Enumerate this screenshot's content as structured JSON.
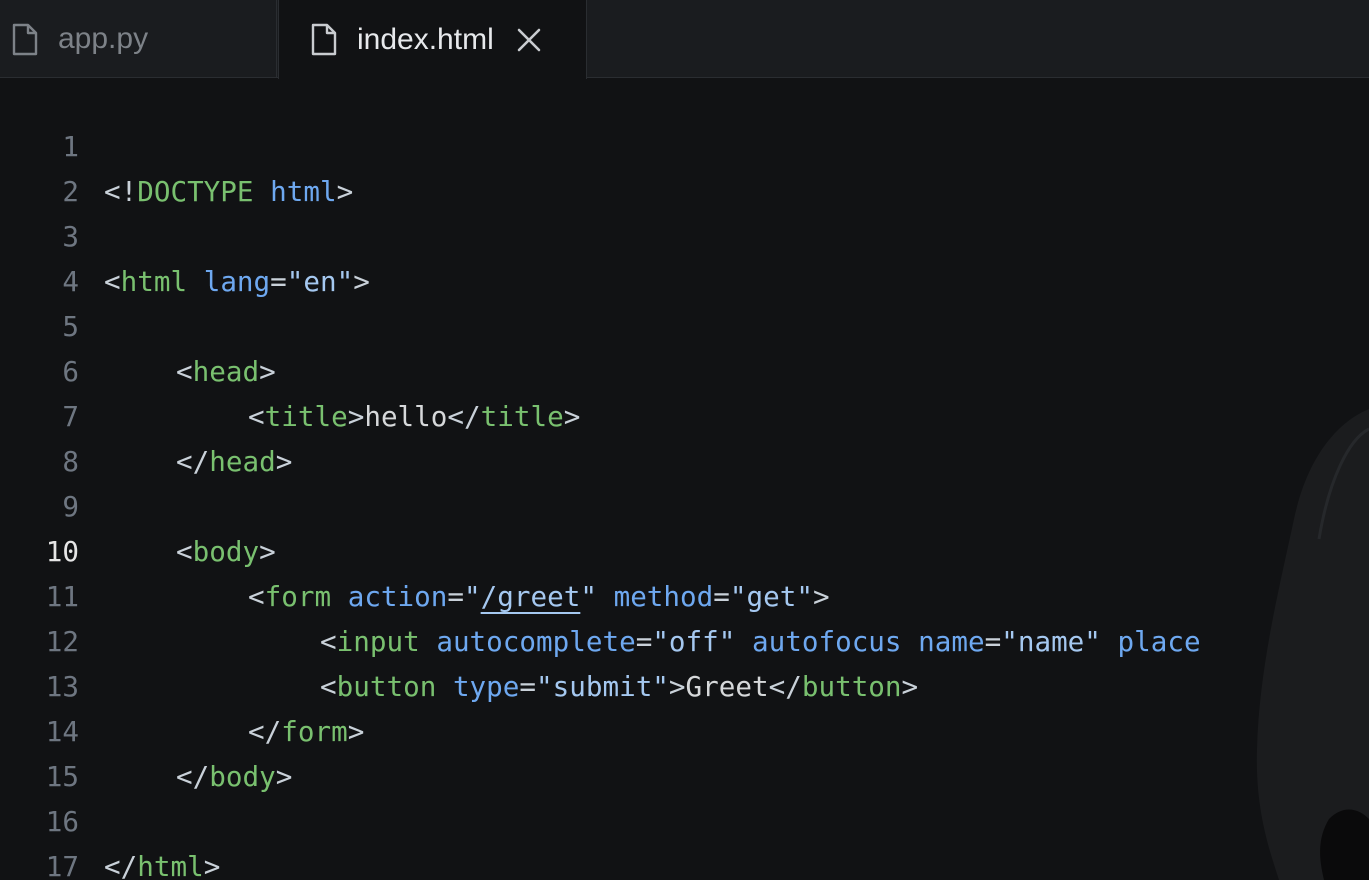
{
  "tabs": [
    {
      "label": "app.py",
      "active": false,
      "icon": "file-icon"
    },
    {
      "label": "index.html",
      "active": true,
      "icon": "file-icon",
      "close_icon": "close-icon"
    }
  ],
  "editor": {
    "active_line": "10",
    "lines": [
      {
        "number": "1"
      },
      {
        "number": "2"
      },
      {
        "number": "3"
      },
      {
        "number": "4"
      },
      {
        "number": "5"
      },
      {
        "number": "6"
      },
      {
        "number": "7"
      },
      {
        "number": "8"
      },
      {
        "number": "9"
      },
      {
        "number": "10"
      },
      {
        "number": "11"
      },
      {
        "number": "12"
      },
      {
        "number": "13"
      },
      {
        "number": "14"
      },
      {
        "number": "15"
      },
      {
        "number": "16"
      },
      {
        "number": "17"
      }
    ],
    "tokens": {
      "l1": {
        "lt": "<!",
        "doctype": "DOCTYPE",
        "sp": " ",
        "html": "html",
        "gt": ">"
      },
      "l3": {
        "lt": "<",
        "tag": "html",
        "attr": "lang",
        "eq": "=",
        "val": "\"en\"",
        "gt": ">"
      },
      "l5": {
        "lt": "<",
        "tag": "head",
        "gt": ">"
      },
      "l6": {
        "lt": "<",
        "tag": "title",
        "gt": ">",
        "text": "hello",
        "lt2": "</",
        "tag2": "title",
        "gt2": ">"
      },
      "l7": {
        "lt": "</",
        "tag": "head",
        "gt": ">"
      },
      "l9": {
        "lt": "<",
        "tag": "body",
        "gt": ">"
      },
      "l10": {
        "lt": "<",
        "tag": "form",
        "attr1": "action",
        "eq1": "=",
        "q1": "\"",
        "val1": "/greet",
        "q1b": "\"",
        "attr2": "method",
        "eq2": "=",
        "val2": "\"get\"",
        "gt": ">"
      },
      "l11": {
        "lt": "<",
        "tag": "input",
        "attr1": "autocomplete",
        "eq1": "=",
        "val1": "\"off\"",
        "attr2": "autofocus",
        "attr3": "name",
        "eq3": "=",
        "val3": "\"name\"",
        "attr4": "place"
      },
      "l12": {
        "lt": "<",
        "tag": "button",
        "attr": "type",
        "eq": "=",
        "val": "\"submit\"",
        "gt": ">",
        "text": "Greet",
        "lt2": "</",
        "tag2": "button",
        "gt2": ">"
      },
      "l13": {
        "lt": "</",
        "tag": "form",
        "gt": ">"
      },
      "l14": {
        "lt": "</",
        "tag": "body",
        "gt": ">"
      },
      "l16": {
        "lt": "</",
        "tag": "html",
        "gt": ">"
      }
    }
  },
  "colors": {
    "background": "#111214",
    "tag": "#79c06f",
    "attribute": "#6ea8f0",
    "string": "#a5c8f0",
    "punctuation": "#c9d1d9",
    "line_number": "#6e7681"
  }
}
